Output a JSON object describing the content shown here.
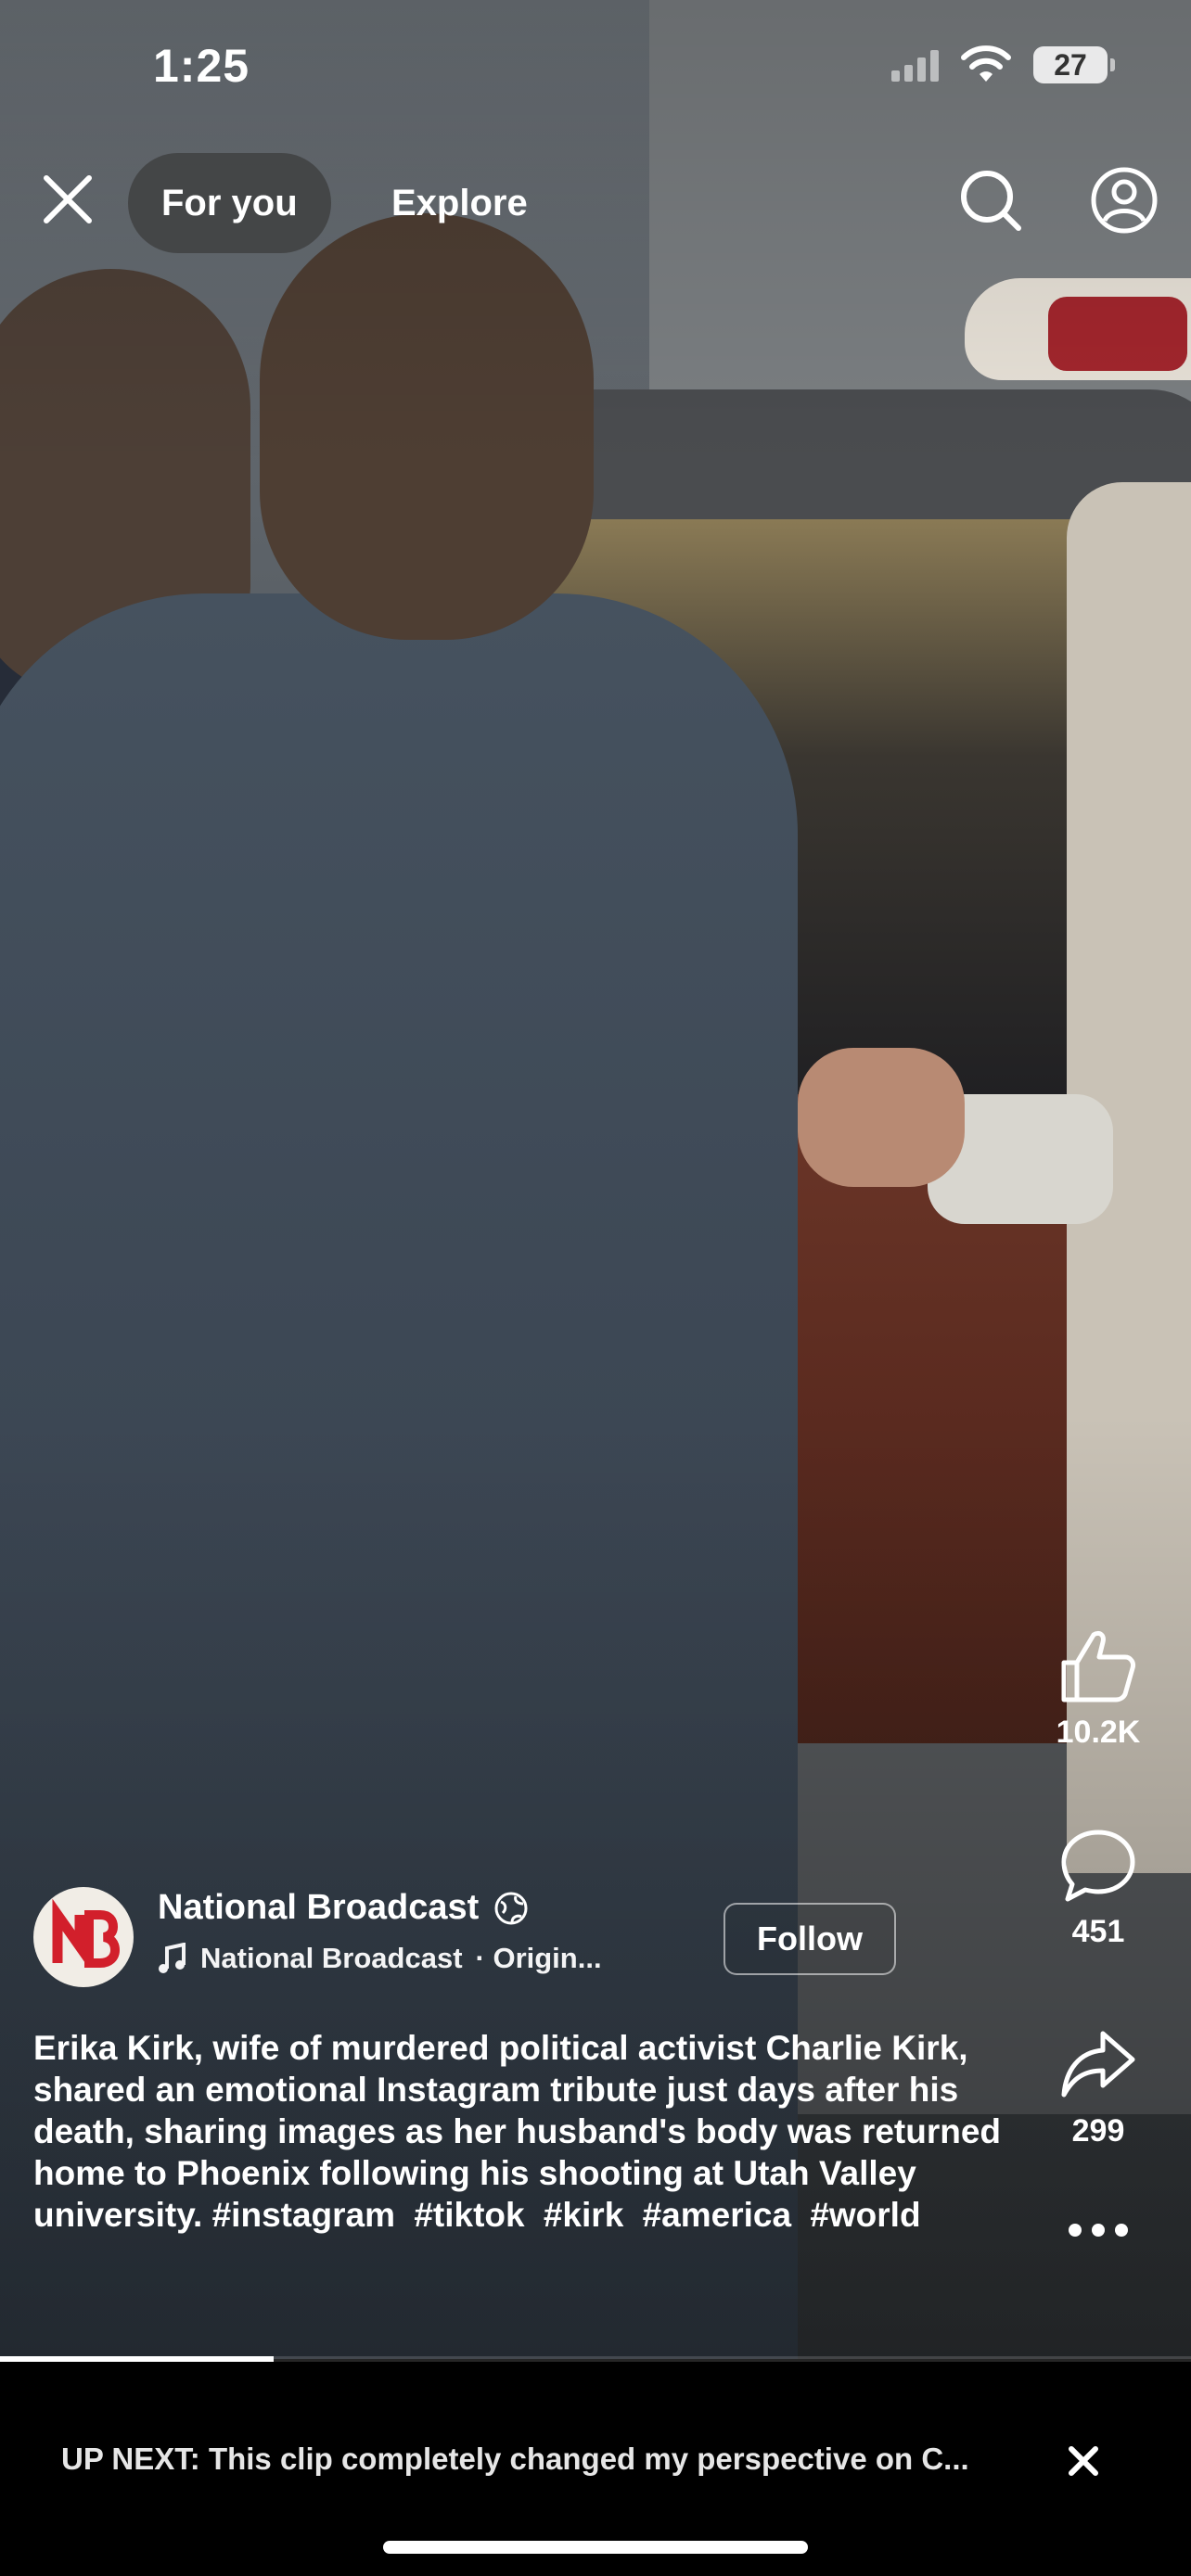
{
  "status_bar": {
    "time": "1:25",
    "battery": "27"
  },
  "top_nav": {
    "tabs": [
      "For you",
      "Explore"
    ]
  },
  "actions": {
    "likes": "10.2K",
    "comments": "451",
    "shares": "299"
  },
  "post": {
    "author": "National Broadcast",
    "audio": "National Broadcast",
    "audio_suffix": "· Origin...",
    "follow_label": "Follow",
    "avatar_text": "NB",
    "caption_text": "Erika Kirk, wife of murdered political activist Charlie Kirk, shared an emotional Instagram tribute just days after his death, sharing images as her husband's body was returned home to Phoenix following his shooting at Utah Valley university.",
    "hashtags": [
      "#instagram",
      "#tiktok",
      "#kirk",
      "#america",
      "#world"
    ]
  },
  "playback": {
    "progress_fraction": 0.23
  },
  "up_next": {
    "label": "UP NEXT:",
    "title": "This clip completely changed my perspective on C..."
  },
  "colors": {
    "avatar_red": "#d21f2b",
    "overlay_button": "#3c3c3c"
  }
}
